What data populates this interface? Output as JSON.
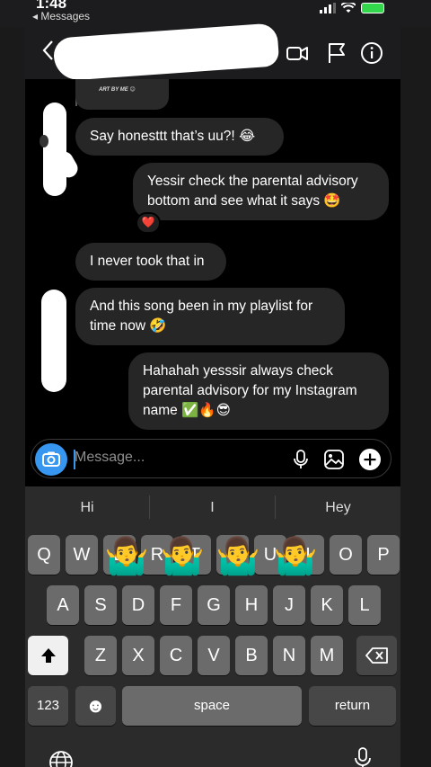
{
  "status": {
    "time": "1:48",
    "back_label": "◂ Messages"
  },
  "header": {
    "icons": [
      "back-chevron-icon",
      "video-call-icon",
      "flag-icon",
      "info-icon"
    ]
  },
  "chat": {
    "shared_card_label": "ART BY ME 😊",
    "messages": [
      {
        "side": "in",
        "text": "Say honesttt that’s uu?! 😂"
      },
      {
        "side": "out",
        "text": "Yessir check the parental advisory bottom and see what it says 🤩",
        "reaction": "❤️"
      },
      {
        "side": "in",
        "text": "I never took that in"
      },
      {
        "side": "in",
        "text": "And this song been in my playlist for time now 🤣"
      },
      {
        "side": "out",
        "text": "Hahahah yesssir always check parental advisory for my Instagram name ✅🔥😎"
      }
    ]
  },
  "composer": {
    "placeholder": "Message..."
  },
  "keyboard": {
    "suggestions": [
      "Hi",
      "I",
      "Hey"
    ],
    "row1": [
      "Q",
      "W",
      "E",
      "R",
      "T",
      "Y",
      "U",
      "I",
      "O",
      "P"
    ],
    "row2": [
      "A",
      "S",
      "D",
      "F",
      "G",
      "H",
      "J",
      "K",
      "L"
    ],
    "row3": [
      "Z",
      "X",
      "C",
      "V",
      "B",
      "N",
      "M"
    ],
    "numbers_label": "123",
    "emoji_key": "☻",
    "space_label": "space",
    "return_label": "return",
    "overlay_emoji": "🤷‍♂️"
  }
}
